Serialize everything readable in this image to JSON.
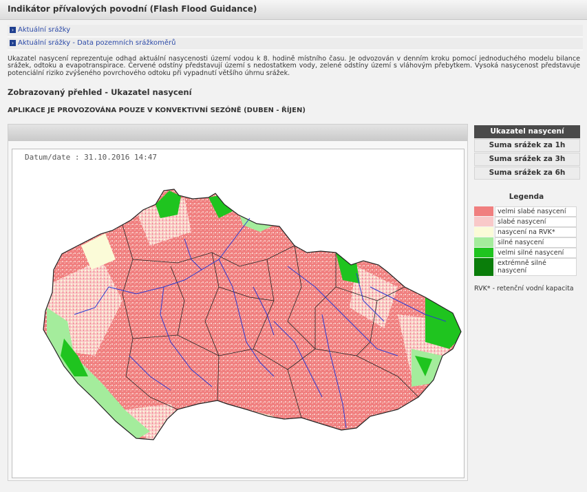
{
  "page": {
    "title": "Indikátor přívalových povodní (Flash Flood Guidance)"
  },
  "links": [
    {
      "label": "Aktuální srážky"
    },
    {
      "label": "Aktuální srážky - Data pozemních srážkoměrů"
    }
  ],
  "description": "Ukazatel nasycení reprezentuje odhad aktuální nasycenosti území vodou k 8. hodině místního času. Je odvozován v denním kroku pomocí jednoduchého modelu bilance srážek, odtoku a evapotranspirace. Červené odstíny představují území s nedostatkem vody, zelené odstíny území s vláhovým přebytkem. Vysoká nasycenost představuje potenciální riziko zvýšeného povrchového odtoku při vypadnutí většího úhrnu srážek.",
  "overview_heading": "Zobrazovaný přehled - Ukazatel nasycení",
  "season_note": "APLIKACE JE PROVOZOVÁNA POUZE V KONVEKTIVNÍ SEZÓNĚ (DUBEN - ŘÍJEN)",
  "map": {
    "date_label": "Datum/date : 31.10.2016 14:47"
  },
  "side_buttons": [
    {
      "label": "Ukazatel nasycení",
      "active": true
    },
    {
      "label": "Suma srážek za 1h",
      "active": false
    },
    {
      "label": "Suma srážek za 3h",
      "active": false
    },
    {
      "label": "Suma srážek za 6h",
      "active": false
    }
  ],
  "legend": {
    "title": "Legenda",
    "items": [
      {
        "label": "velmi slabé nasycení",
        "color": "#f07f7f"
      },
      {
        "label": "slabé nasycení",
        "color": "#f9c9c9"
      },
      {
        "label": "nasycení na RVK*",
        "color": "#fbfbd8"
      },
      {
        "label": "silné nasycení",
        "color": "#a4ec9c"
      },
      {
        "label": "velmi silné nasycení",
        "color": "#1fc41f"
      },
      {
        "label": "extrémně silné nasycení",
        "color": "#0a7d0a"
      }
    ],
    "footnote": "RVK* - retenční vodní kapacita"
  }
}
